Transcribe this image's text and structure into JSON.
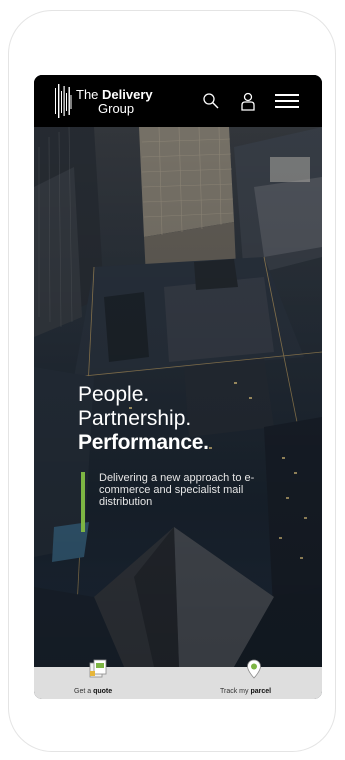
{
  "brand": {
    "name_prefix": "The",
    "name_bold": "Delivery",
    "name_line2": "Group"
  },
  "header": {
    "icons": [
      "search-icon",
      "user-icon",
      "menu-icon"
    ]
  },
  "hero": {
    "headline_line1": "People.",
    "headline_line2": "Partnership.",
    "headline_line3": "Performance.",
    "tagline": "Delivering a new approach to e-commerce and specialist mail distribution"
  },
  "bottom_bar": {
    "quote_prefix": "Get a",
    "quote_bold": "quote",
    "track_prefix": "Track my",
    "track_bold": "parcel"
  },
  "colors": {
    "accent_green": "#7db543",
    "header_bg": "#000000",
    "bottom_bar_bg": "#dedede"
  }
}
